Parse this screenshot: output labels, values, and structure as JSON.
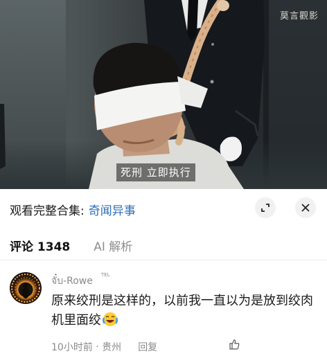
{
  "video": {
    "watermark": "莫言觀影",
    "subtitle": "死刑  立即执行"
  },
  "series": {
    "prefix": "观看完整合集:",
    "link": "奇闻异事"
  },
  "tabs": {
    "comments": "评论 1348",
    "ai": "AI 解析"
  },
  "comment": {
    "username": "จั๋บ-Rowe",
    "username_tag": "TEL",
    "text": "原来绞刑是这样的，以前我一直以为是放到绞肉机里面绞",
    "time": "10小时前",
    "location": "贵州",
    "reply": "回复"
  },
  "icons": [
    "expand-icon",
    "close-icon",
    "laughing-crying-emoji",
    "like-icon"
  ],
  "colors": {
    "link": "#2f6fb5",
    "muted": "#8a8a8a",
    "text": "#1a1a1a"
  }
}
